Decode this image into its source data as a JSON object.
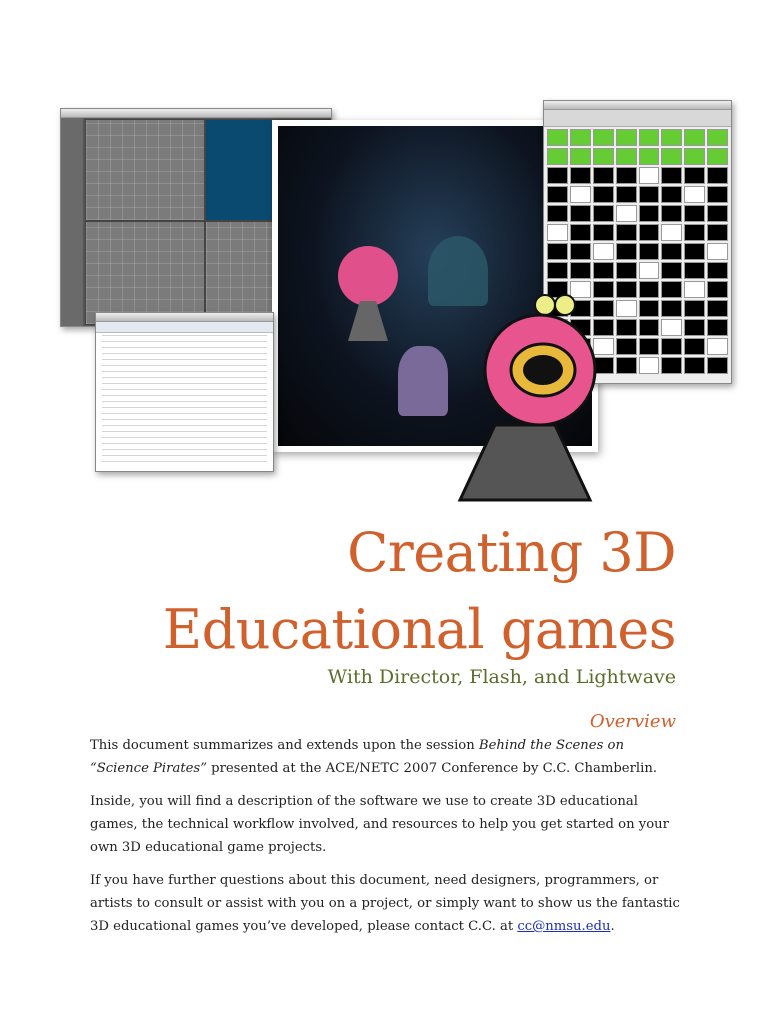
{
  "title": {
    "line1": "Creating 3D",
    "line2": "Educational games"
  },
  "subtitle": "With Director, Flash, and Lightwave",
  "section_heading": "Overview",
  "paragraphs": {
    "p1": {
      "before": "This document summarizes and extends upon the session ",
      "italic": "Behind the Scenes on “Science Pirates”",
      "after": " presented at the ACE/NETC 2007 Conference by C.C. Chamberlin."
    },
    "p2": "Inside, you will find a description of the software we use to create 3D educational games, the technical workflow involved, and resources to help you get started on your own 3D educational game projects.",
    "p3": {
      "before": "If you have further questions about this document, need designers, programmers, or artists to consult or assist with you on a project, or simply want to show us the fantastic 3D educational games you’ve developed, please contact C.C. at ",
      "link": "cc@nmsu.edu",
      "after": "."
    }
  },
  "colors": {
    "title": "#d0602c",
    "subtitle": "#5b6d2b",
    "link": "#1a2fbf"
  }
}
